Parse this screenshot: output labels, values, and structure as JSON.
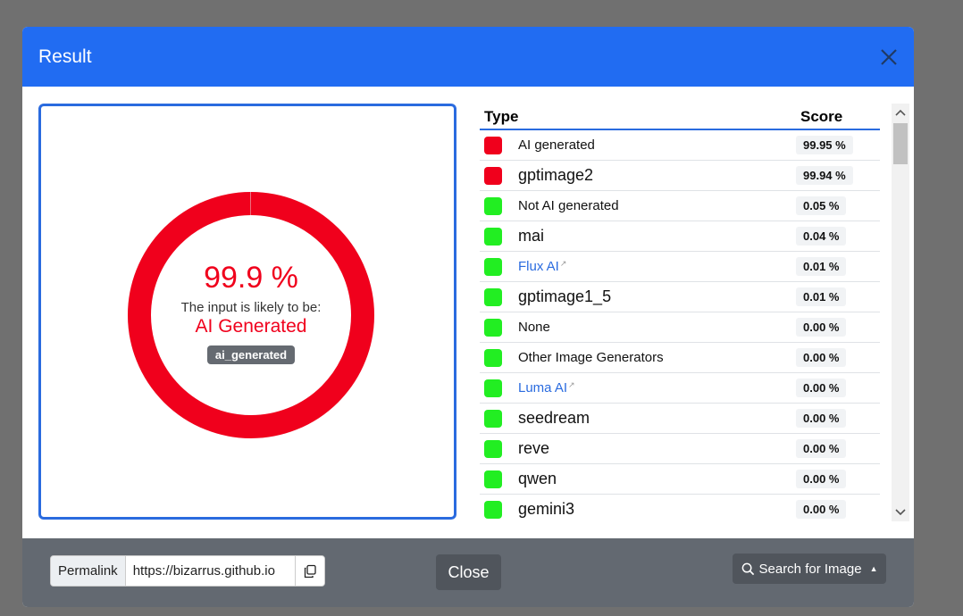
{
  "dialog": {
    "title": "Result",
    "close_icon": "close-icon"
  },
  "result": {
    "percent": "99.9 %",
    "likely_text": "The input is likely to be:",
    "verdict": "AI Generated",
    "tag": "ai_generated",
    "ring_value": 0.999,
    "ring_color": "#f0001c"
  },
  "table": {
    "headers": {
      "type": "Type",
      "score": "Score"
    },
    "rows": [
      {
        "name": "AI generated",
        "score": "99.95 %",
        "color": "#f0001c",
        "style": "small"
      },
      {
        "name": "gptimage2",
        "score": "99.94 %",
        "color": "#f0001c",
        "style": "big"
      },
      {
        "name": "Not AI generated",
        "score": "0.05 %",
        "color": "#22ee22",
        "style": "small"
      },
      {
        "name": "mai",
        "score": "0.04 %",
        "color": "#22ee22",
        "style": "big"
      },
      {
        "name": "Flux AI",
        "score": "0.01 %",
        "color": "#22ee22",
        "style": "link"
      },
      {
        "name": "gptimage1_5",
        "score": "0.01 %",
        "color": "#22ee22",
        "style": "big"
      },
      {
        "name": "None",
        "score": "0.00 %",
        "color": "#22ee22",
        "style": "small"
      },
      {
        "name": "Other Image Generators",
        "score": "0.00 %",
        "color": "#22ee22",
        "style": "small"
      },
      {
        "name": "Luma AI",
        "score": "0.00 %",
        "color": "#22ee22",
        "style": "link"
      },
      {
        "name": "seedream",
        "score": "0.00 %",
        "color": "#22ee22",
        "style": "big"
      },
      {
        "name": "reve",
        "score": "0.00 %",
        "color": "#22ee22",
        "style": "big"
      },
      {
        "name": "qwen",
        "score": "0.00 %",
        "color": "#22ee22",
        "style": "big"
      },
      {
        "name": "gemini3",
        "score": "0.00 %",
        "color": "#22ee22",
        "style": "big"
      }
    ]
  },
  "footer": {
    "permalink_label": "Permalink",
    "permalink_value": "https://bizarrus.github.io",
    "close_label": "Close",
    "search_label": "Search for Image"
  },
  "colors": {
    "header": "#216cf2",
    "accent": "#2a6bdf",
    "footer": "#636971"
  }
}
